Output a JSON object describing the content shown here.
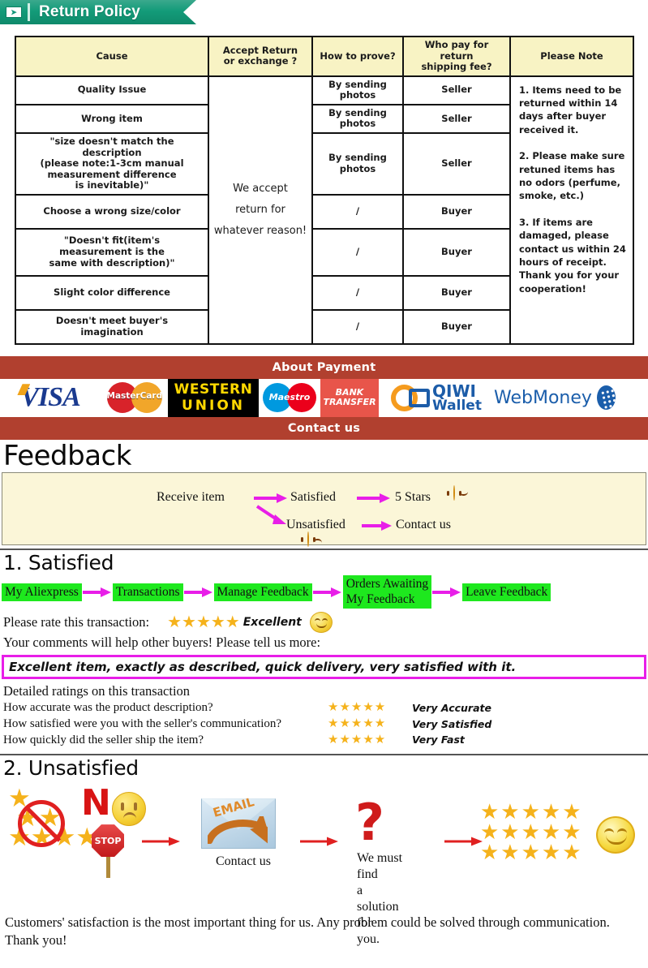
{
  "return_policy": {
    "banner_title": "Return Policy",
    "banner_icon": "arrow-right-icon",
    "table": {
      "headers": [
        "Cause",
        "Accept Return\nor exchange ?",
        "How to prove?",
        "Who pay for return\nshipping fee?",
        "Please Note"
      ],
      "accept_cell": "We accept\nreturn for\nwhatever reason!",
      "rows": [
        {
          "cause": "Quality Issue",
          "prove": "By sending\nphotos",
          "who_pays": "Seller"
        },
        {
          "cause": "Wrong item",
          "prove": "By sending\nphotos",
          "who_pays": "Seller"
        },
        {
          "cause": "\"size doesn't match the description\n(please note:1-3cm manual\nmeasurement difference\nis inevitable)\"",
          "prove": "By sending\nphotos",
          "who_pays": "Seller"
        },
        {
          "cause": "Choose a wrong size/color",
          "prove": "/",
          "who_pays": "Buyer"
        },
        {
          "cause": "\"Doesn't fit(item's\nmeasurement is the\nsame with description)\"",
          "prove": "/",
          "who_pays": "Buyer"
        },
        {
          "cause": "Slight color difference",
          "prove": "/",
          "who_pays": "Buyer"
        },
        {
          "cause": "Doesn't meet buyer's\nimagination",
          "prove": "/",
          "who_pays": "Buyer"
        }
      ],
      "note": "1. Items need to be returned within 14 days after buyer received it.\n\n2. Please make sure retuned items has no odors (perfume, smoke, etc.)\n\n3. If items are damaged, please contact us within 24 hours of receipt.\nThank you for your cooperation!"
    }
  },
  "payment": {
    "title": "About Payment",
    "contact_title": "Contact us",
    "bar_color": "#b1402f",
    "logos": [
      {
        "name": "visa",
        "label": "VISA"
      },
      {
        "name": "mastercard",
        "label": "MasterCard"
      },
      {
        "name": "western-union",
        "label_line1": "WESTERN",
        "label_line2": "UNION"
      },
      {
        "name": "maestro",
        "label": "Maestro"
      },
      {
        "name": "bank-transfer",
        "label_line1": "BANK",
        "label_line2": "TRANSFER"
      },
      {
        "name": "qiwi-wallet",
        "label_line1": "QIWI",
        "label_line2": "Wallet"
      },
      {
        "name": "webmoney",
        "label": "WebMoney"
      }
    ]
  },
  "feedback": {
    "title": "Feedback",
    "flow": {
      "start": "Receive item",
      "satisfied": "Satisfied",
      "satisfied_result": "5 Stars",
      "unsatisfied": "Unsatisfied",
      "unsatisfied_result": "Contact us"
    }
  },
  "satisfied": {
    "title": "1. Satisfied",
    "steps": [
      "My Aliexpress",
      "Transactions",
      "Manage Feedback",
      "Orders Awaiting\nMy Feedback",
      "Leave Feedback"
    ],
    "rate_label": "Please rate this transaction:",
    "rate_stars": "★★★★★",
    "rate_word": "Excellent",
    "comments_prompt": "Your comments will help other buyers! Please tell us more:",
    "comment_text": "Excellent item, exactly as described, quick delivery, very satisfied with it.",
    "detail_title": "Detailed ratings on this transaction",
    "details": [
      {
        "question": "How accurate was the product description?",
        "stars": "★★★★★",
        "value": "Very Accurate"
      },
      {
        "question": "How satisfied were you with the seller's communication?",
        "stars": "★★★★★",
        "value": "Very Satisfied"
      },
      {
        "question": "How quickly did the seller ship the item?",
        "stars": "★★★★★",
        "value": "Very Fast"
      }
    ],
    "highlight_color": "#1ee81e",
    "box_border_color": "#e81ee8",
    "star_color": "#f5b21b"
  },
  "unsatisfied": {
    "title": "2. Unsatisfied",
    "no_text": "N",
    "stop_text": "STOP",
    "email_text": "EMAIL",
    "contact_label": "Contact us",
    "solution_label": "We must find\na solution for\nyou.",
    "question_mark": "?",
    "closing": "Customers' satisfaction is the most important thing for us. Any problem could be solved through communication. Thank you!",
    "arrow_color": "#e02020"
  }
}
